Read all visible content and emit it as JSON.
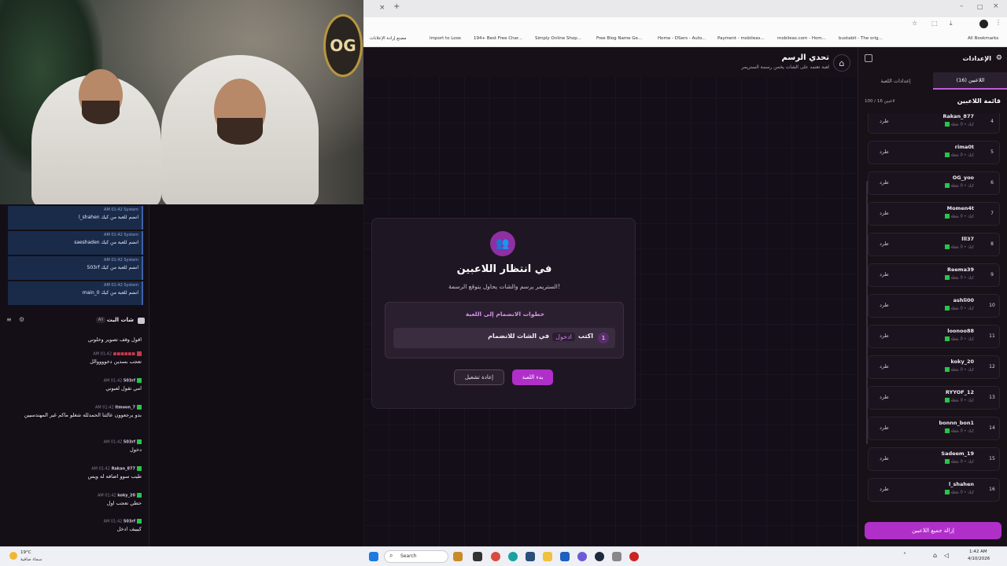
{
  "browser": {
    "new_tab": "+",
    "bookmarks": [
      "مصنع إرادة الإعلانات",
      "Import to Loox",
      "194+ Best Free Char...",
      "Simply Online Shop...",
      "Free Blog Name Ge...",
      "Home - DSers - Auto...",
      "Payment - mobileas...",
      "mobileas.com - Hom...",
      "bustabit - The orig...",
      "All Bookmarks"
    ]
  },
  "game": {
    "title": "تحدي الرسم",
    "subtitle": "لعبة تعتمد على الشات يخمن رسمة الستريمر",
    "waiting_title": "في انتظار اللاعبين",
    "waiting_desc": "الستريمر يرسم والشات يحاول يتوقع الرسمة!",
    "steps_title": "خطوات الانضمام إلى اللعبة",
    "step_num": "1",
    "step_pre": "اكتب",
    "step_kw": "ادخول",
    "step_post": "في الشات للانضمام",
    "restart": "إعادة تشغيل",
    "start": "بدء اللعبة"
  },
  "settings": {
    "title": "الإعدادات",
    "tab_players": "اللاعبين (16)",
    "tab_game": "إعدادات اللعبة",
    "list_title": "قائمة اللاعبين",
    "count": "100 / 16 لاعبين",
    "kick": "طرد",
    "sub": "كيك • 0 نقطة",
    "players": [
      {
        "n": "4",
        "name": "Rakan_877"
      },
      {
        "n": "5",
        "name": "rima0t"
      },
      {
        "n": "6",
        "name": "OG_yoo"
      },
      {
        "n": "7",
        "name": "Momen4t"
      },
      {
        "n": "8",
        "name": "lll37"
      },
      {
        "n": "9",
        "name": "Reema39"
      },
      {
        "n": "10",
        "name": "ashli00"
      },
      {
        "n": "11",
        "name": "loonoo88"
      },
      {
        "n": "12",
        "name": "koky_20"
      },
      {
        "n": "13",
        "name": "RYYOF_12"
      },
      {
        "n": "14",
        "name": "bonnn_bon1"
      },
      {
        "n": "15",
        "name": "Sadeem_19"
      },
      {
        "n": "16",
        "name": "l_shahen"
      }
    ],
    "remove_all": "إزالة جميع اللاعبين"
  },
  "system_msgs": [
    {
      "meta": "AM 01:42 System",
      "text": "l_shahen انضم للعبة من كيك"
    },
    {
      "meta": "AM 01:42 System",
      "text": "saeshaden انضم للعبة من كيك"
    },
    {
      "meta": "AM 01:42 System",
      "text": "503rf انضم للعبة من كيك"
    },
    {
      "meta": "AM 01:42 System",
      "text": "main_0 انضم للعبة من كيك"
    }
  ],
  "chat": {
    "title": "شات البث",
    "badge": "All",
    "messages": [
      {
        "time": "",
        "user": "",
        "text": "اقول وقف تصوير وخلوني"
      },
      {
        "time": "AM 01:42",
        "user": "",
        "text": "تعجب بسدين دخووووالل"
      },
      {
        "time": "AM 01:42",
        "user": "503rf",
        "text": "امي تقول لعبوني"
      },
      {
        "time": "AM 01:42",
        "user": "ltmoon_7",
        "text": "بدو يرجعوون عالثنا الحمدلله شغلو ماكم غير المهندسيين"
      },
      {
        "time": "AM 01:42",
        "user": "503rf",
        "text": "دخول"
      },
      {
        "time": "AM 01:42",
        "user": "Rakan_877",
        "text": "طيب سوو اضافه له ويس"
      },
      {
        "time": "AM 01:42",
        "user": "koky_20",
        "text": "حطي تعجب اول"
      },
      {
        "time": "AM 01:42",
        "user": "503rf",
        "text": "كيييف ادخل"
      }
    ]
  },
  "taskbar": {
    "search": "Search",
    "weather": "19°C",
    "weather_sub": "سماء صافية",
    "time": "1:42 AM",
    "date": "4/10/2026"
  }
}
